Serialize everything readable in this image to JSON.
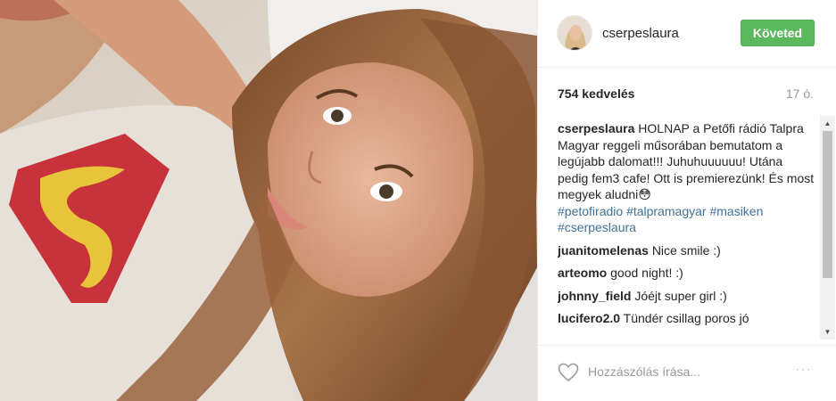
{
  "post": {
    "username": "cserpeslaura",
    "follow_label": "Követed",
    "likes": "754 kedvelés",
    "timestamp": "17 ó.",
    "caption_user": "cserpeslaura",
    "caption_text": "HOLNAP a Petőfi rádió Talpra Magyar reggeli műsorában bemutatom a legújabb dalomat!!! Juhuhuuuuuu! Utána pedig fem3 cafe! Ott is premierezünk! És most megyek aludni😳",
    "hashtags": [
      "#petofiradio",
      "#talpramagyar",
      "#masiken",
      "#cserpeslaura"
    ],
    "comments": [
      {
        "user": "juanitomelenas",
        "text": "Nice smile :)"
      },
      {
        "user": "arteomo",
        "text": "good night! :)"
      },
      {
        "user": "johnny_field",
        "text": "Jóéjt super girl :)"
      },
      {
        "user": "lucifero2.0",
        "text": "Tündér csillag poros jó"
      }
    ],
    "comment_placeholder": "Hozzászólás írása...",
    "more_label": "···"
  },
  "colors": {
    "follow_bg": "#5cb85c",
    "hashtag": "#3f729b",
    "muted": "#999999"
  },
  "icons": {
    "like": "heart-outline-icon",
    "more": "more-options-icon"
  }
}
